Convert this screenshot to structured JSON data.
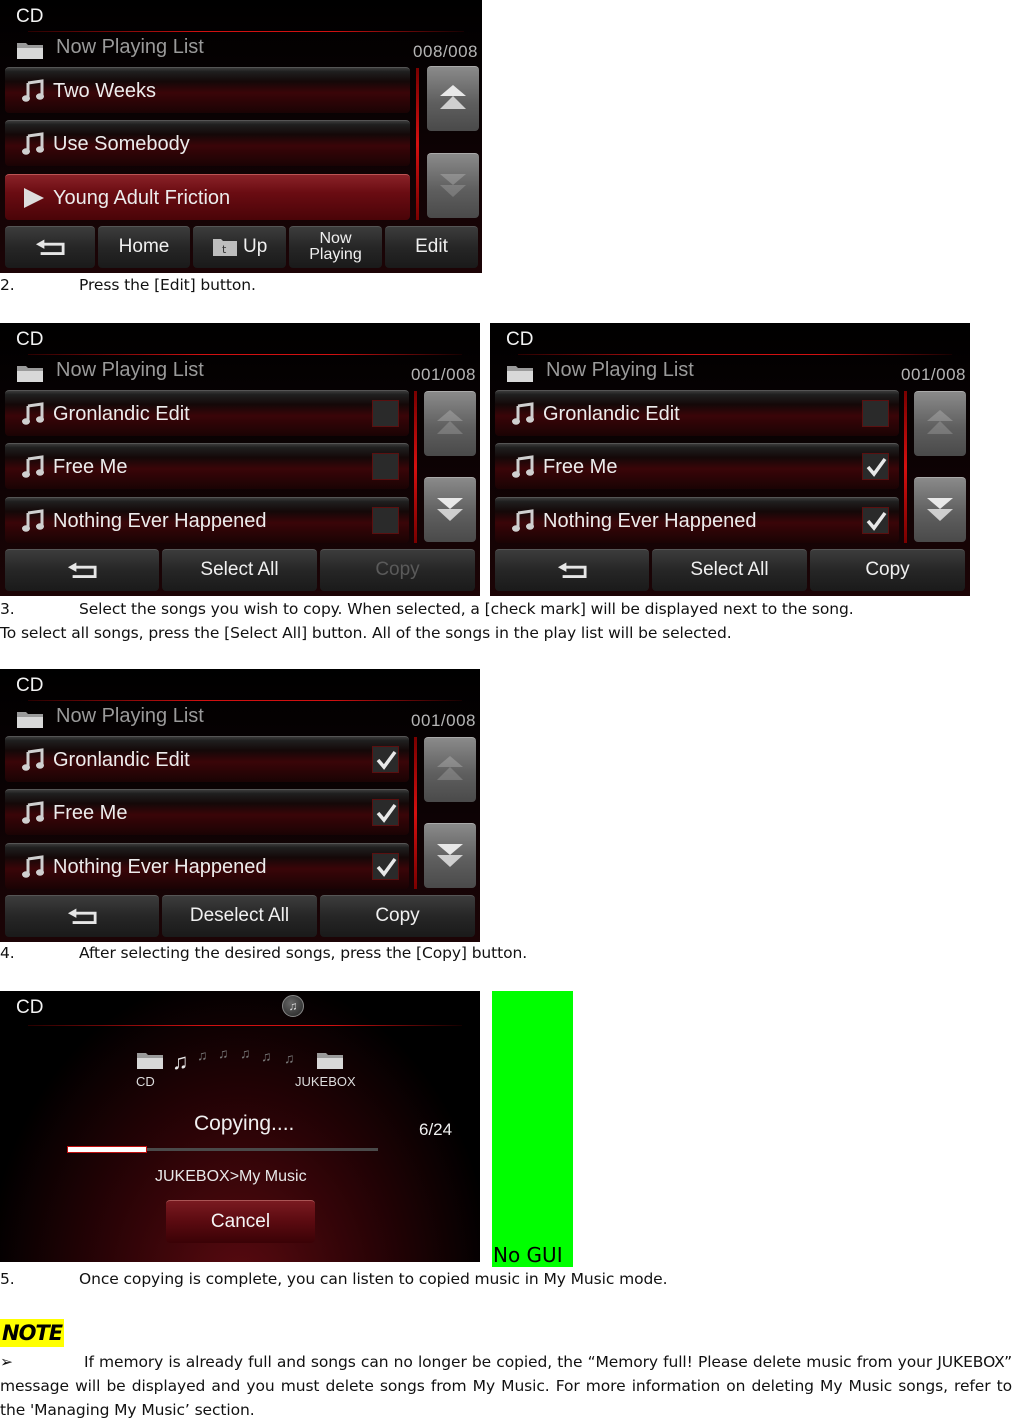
{
  "screens": {
    "playlist": {
      "mode": "CD",
      "list_title": "Now Playing List",
      "counter": "008/008",
      "songs": [
        {
          "title": "Two Weeks",
          "icon": "music-note-icon",
          "playing": false
        },
        {
          "title": "Use Somebody",
          "icon": "music-note-icon",
          "playing": false
        },
        {
          "title": "Young Adult Friction",
          "icon": "play-icon",
          "playing": true
        }
      ],
      "buttons": {
        "back": "back-arrow-icon",
        "home": "Home",
        "up": "Up",
        "now_playing_line1": "Now",
        "now_playing_line2": "Playing",
        "edit": "Edit"
      }
    },
    "edit_none": {
      "mode": "CD",
      "list_title": "Now Playing List",
      "counter": "001/008",
      "songs": [
        {
          "title": "Gronlandic Edit",
          "checked": false
        },
        {
          "title": "Free Me",
          "checked": false
        },
        {
          "title": "Nothing Ever Happened",
          "checked": false
        }
      ],
      "buttons": {
        "select_all": "Select All",
        "copy": "Copy",
        "copy_enabled": false
      }
    },
    "edit_some": {
      "mode": "CD",
      "list_title": "Now Playing List",
      "counter": "001/008",
      "songs": [
        {
          "title": "Gronlandic Edit",
          "checked": false
        },
        {
          "title": "Free Me",
          "checked": true
        },
        {
          "title": "Nothing Ever Happened",
          "checked": true
        }
      ],
      "buttons": {
        "select_all": "Select All",
        "copy": "Copy",
        "copy_enabled": true
      }
    },
    "edit_all": {
      "mode": "CD",
      "list_title": "Now Playing List",
      "counter": "001/008",
      "songs": [
        {
          "title": "Gronlandic Edit",
          "checked": true
        },
        {
          "title": "Free Me",
          "checked": true
        },
        {
          "title": "Nothing Ever Happened",
          "checked": true
        }
      ],
      "buttons": {
        "select_all": "Deselect All",
        "copy": "Copy",
        "copy_enabled": true
      }
    },
    "copying": {
      "mode": "CD",
      "source_label": "CD",
      "destination_label": "JUKEBOX",
      "status": "Copying....",
      "count": "6/24",
      "progress": 0.25,
      "destination_path": "JUKEBOX>My Music",
      "cancel": "Cancel"
    }
  },
  "no_gui_label": "No GUI",
  "steps": {
    "step2": {
      "num": "2.",
      "text": "Press the [Edit] button."
    },
    "step3": {
      "num": "3.",
      "text_line1": "Select the songs you wish to copy. When selected, a [check mark] will be displayed next to the song.",
      "text_line2": "To select all songs, press the [Select All] button. All of the songs in the play list will be selected."
    },
    "step4": {
      "num": "4.",
      "text": "After selecting the desired songs, press the [Copy] button."
    },
    "step5": {
      "num": "5.",
      "text": "Once copying is complete, you can listen to copied music in My Music mode."
    }
  },
  "note": {
    "label": "NOTE",
    "bullet": "➢",
    "text": "If memory is already full and songs can no longer be copied, the “Memory full! Please delete music from your JUKEBOX” message will be displayed and you must delete songs from My Music. For more information on deleting My Music songs, refer to the 'Managing My Music’ section."
  },
  "colors": {
    "accent_red": "#d01010",
    "highlight_yellow": "#ffff00",
    "placeholder_green": "#00ff00"
  }
}
